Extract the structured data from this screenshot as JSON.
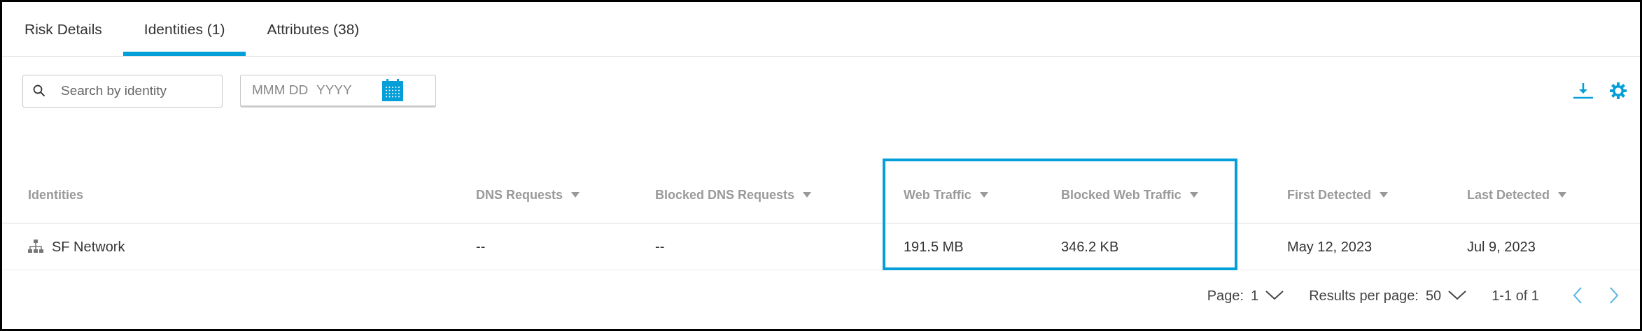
{
  "tabs": [
    {
      "label": "Risk Details",
      "selected": false
    },
    {
      "label": "Identities (1)",
      "selected": true
    },
    {
      "label": "Attributes (38)",
      "selected": false
    }
  ],
  "search": {
    "placeholder": "Search by identity"
  },
  "date_field": {
    "month_day_placeholder": "MMM DD",
    "year_placeholder": "YYYY"
  },
  "table": {
    "columns": [
      {
        "label": "Identities",
        "sortable": false,
        "highlighted": false
      },
      {
        "label": "DNS Requests",
        "sortable": true,
        "highlighted": false
      },
      {
        "label": "Blocked DNS Requests",
        "sortable": true,
        "highlighted": false
      },
      {
        "label": "Web Traffic",
        "sortable": true,
        "highlighted": true
      },
      {
        "label": "Blocked Web Traffic",
        "sortable": true,
        "highlighted": true
      },
      {
        "label": "First Detected",
        "sortable": true,
        "highlighted": false
      },
      {
        "label": "Last Detected",
        "sortable": true,
        "highlighted": false
      }
    ],
    "rows": [
      {
        "cells": [
          "SF Network",
          "--",
          "--",
          "191.5 MB",
          "346.2 KB",
          "May 12, 2023",
          "Jul 9, 2023"
        ]
      }
    ]
  },
  "pagination": {
    "page_label": "Page:",
    "page": "1",
    "per_page_label": "Results per page:",
    "per_page": "50",
    "range": "1-1 of 1"
  }
}
